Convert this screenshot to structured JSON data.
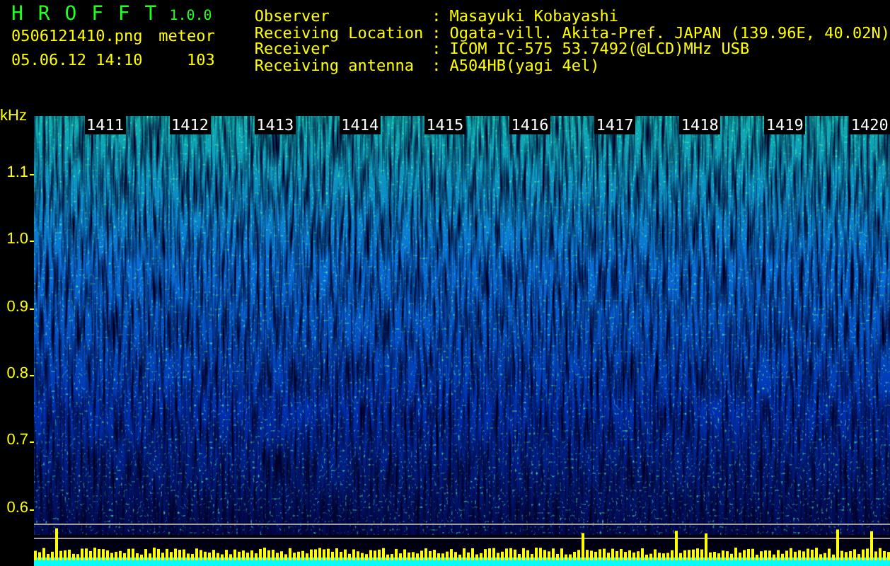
{
  "app": {
    "title": "H R O F F T",
    "version": "1.0.0"
  },
  "file": {
    "name": "0506121410.png",
    "datetime": "05.06.12 14:10"
  },
  "detection": {
    "label": "meteor",
    "count": "103"
  },
  "info": [
    {
      "label": "Observer",
      "separator": ":",
      "value": "Masayuki Kobayashi"
    },
    {
      "label": "Receiving Location",
      "separator": ":",
      "value": "Ogata-vill. Akita-Pref. JAPAN (139.96E, 40.02N)"
    },
    {
      "label": "Receiver",
      "separator": ":",
      "value": "ICOM IC-575 53.7492(@LCD)MHz USB"
    },
    {
      "label": "Receiving antenna",
      "separator": ":",
      "value": "A504HB(yagi 4el)"
    }
  ],
  "y_axis": {
    "unit": "kHz",
    "ticks": [
      "1.1",
      "1.0",
      "0.9",
      "0.8",
      "0.7",
      "0.6"
    ]
  },
  "minute_labels": [
    "1411",
    "1412",
    "1413",
    "1414",
    "1415",
    "1416",
    "1417",
    "1418",
    "1419",
    "1420"
  ]
}
